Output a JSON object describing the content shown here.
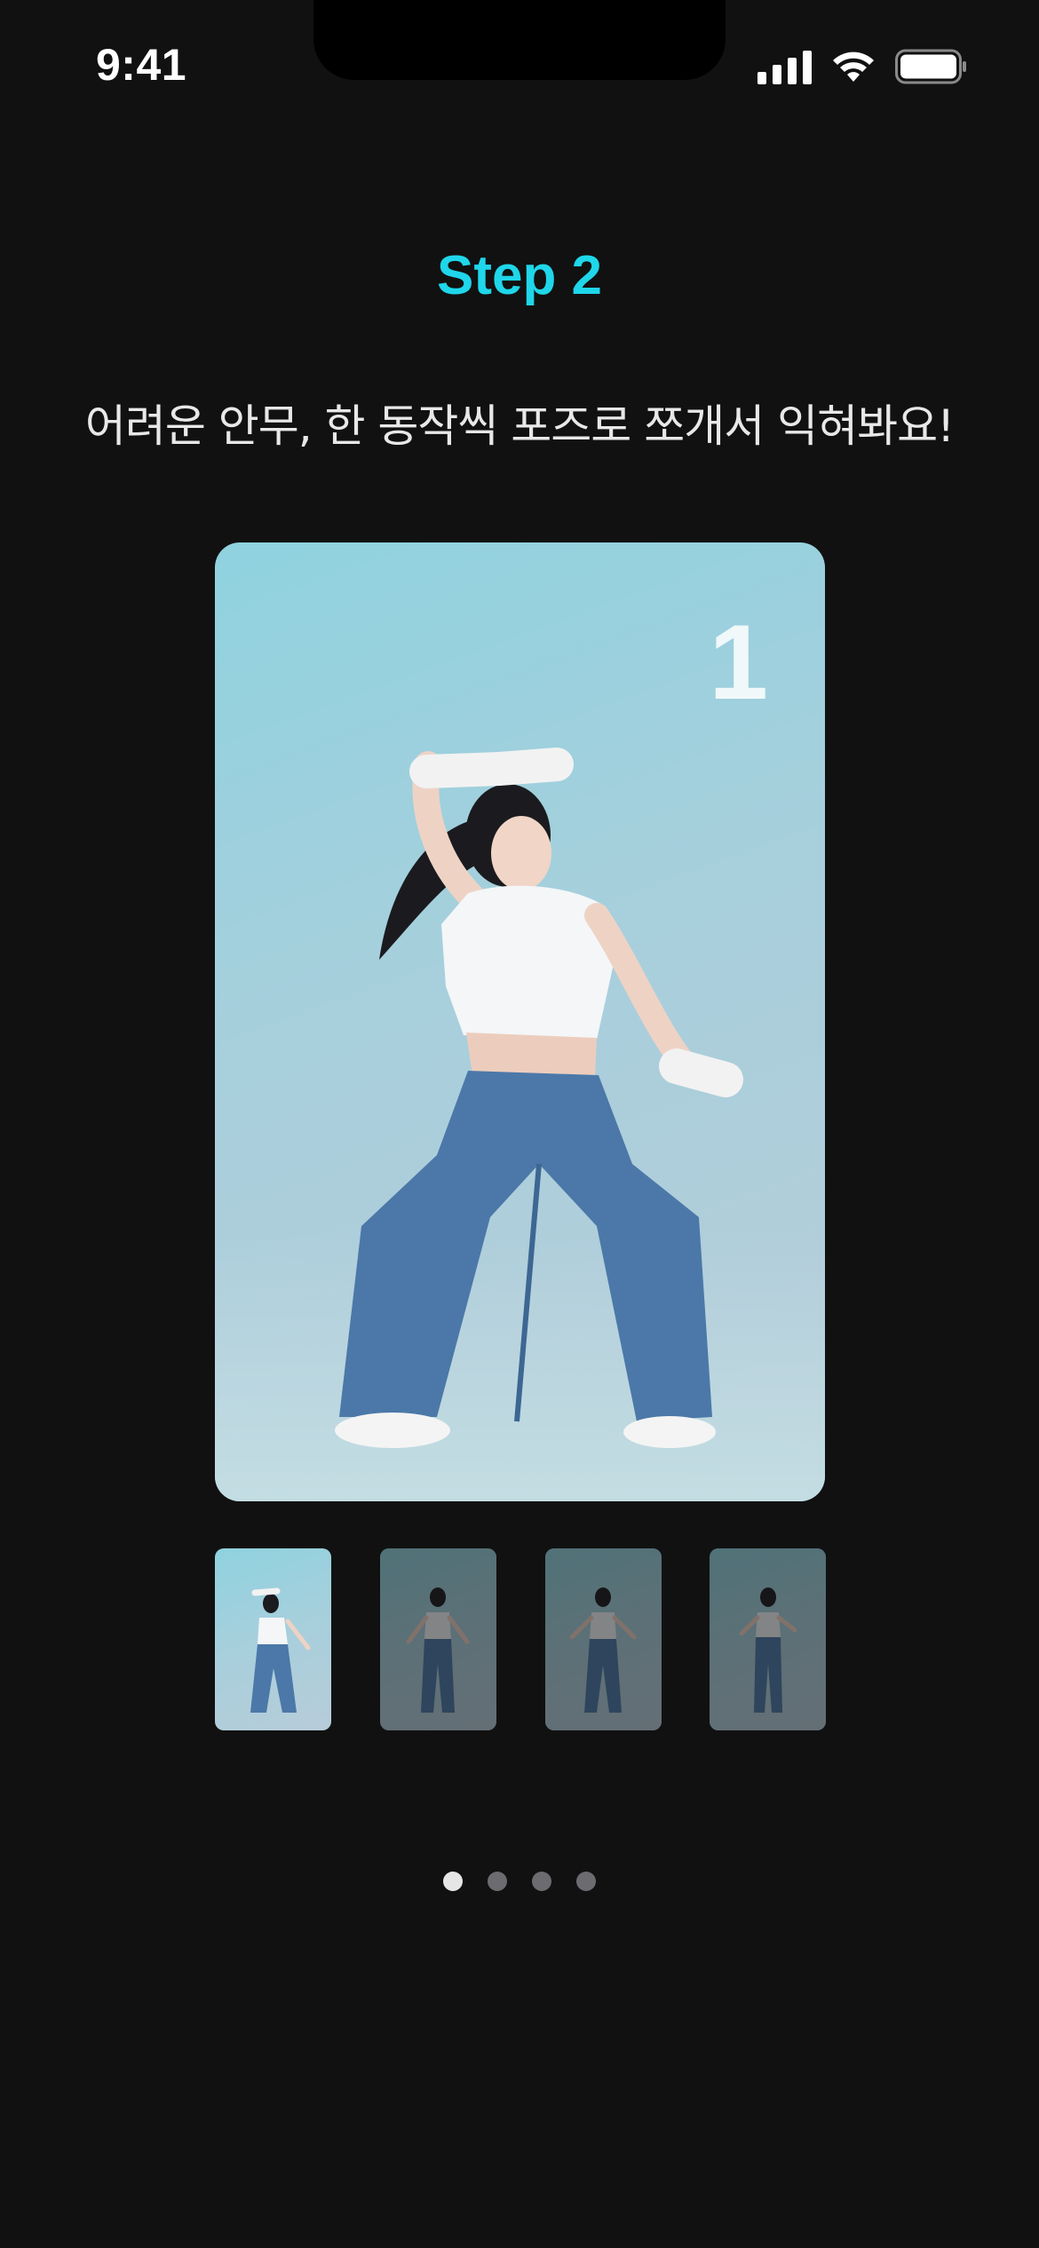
{
  "status_bar": {
    "time": "9:41",
    "icons": [
      "signal-icon",
      "wifi-icon",
      "battery-icon"
    ]
  },
  "header": {
    "step_title": "Step 2",
    "subtitle": "어려운 안무, 한 동작씩 포즈로 쪼개서 익혀봐요!"
  },
  "main_image": {
    "pose_number": "1",
    "description_icon": "dancer-pose-photo"
  },
  "thumbnails": [
    {
      "selected": true
    },
    {
      "selected": false
    },
    {
      "selected": false
    },
    {
      "selected": false
    }
  ],
  "pagination": {
    "total": 4,
    "active_index": 0
  },
  "colors": {
    "background": "#111111",
    "accent": "#1fd6ea",
    "dot_active": "#e6e6e6",
    "dot_inactive": "#6b6b70"
  }
}
